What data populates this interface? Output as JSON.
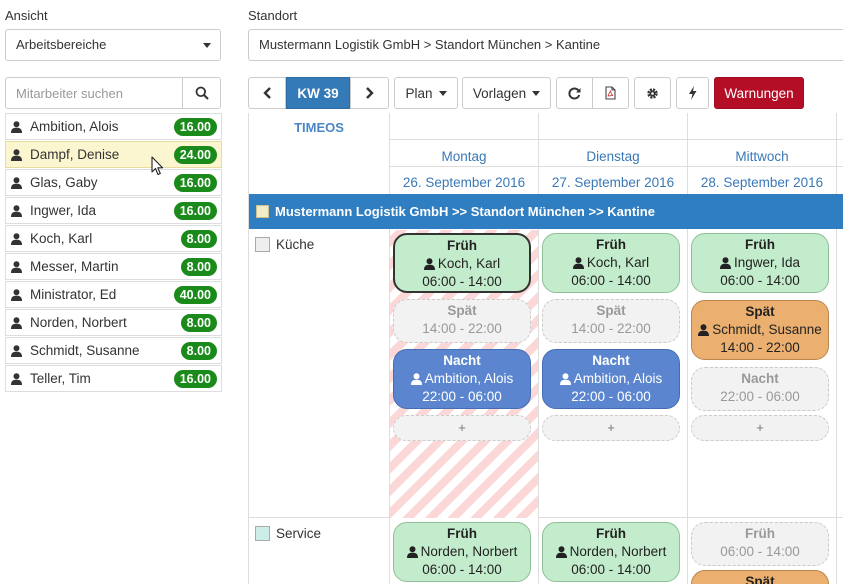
{
  "left": {
    "ansicht_label": "Ansicht",
    "ansicht_value": "Arbeitsbereiche",
    "search_placeholder": "Mitarbeiter suchen",
    "employees": [
      {
        "name": "Ambition, Alois",
        "hours": "16.00"
      },
      {
        "name": "Dampf, Denise",
        "hours": "24.00"
      },
      {
        "name": "Glas, Gaby",
        "hours": "16.00"
      },
      {
        "name": "Ingwer, Ida",
        "hours": "16.00"
      },
      {
        "name": "Koch, Karl",
        "hours": "8.00"
      },
      {
        "name": "Messer, Martin",
        "hours": "8.00"
      },
      {
        "name": "Ministrator, Ed",
        "hours": "40.00"
      },
      {
        "name": "Norden, Norbert",
        "hours": "8.00"
      },
      {
        "name": "Schmidt, Susanne",
        "hours": "8.00"
      },
      {
        "name": "Teller, Tim",
        "hours": "16.00"
      }
    ]
  },
  "standort": {
    "label": "Standort",
    "value": "Mustermann Logistik GmbH > Standort München > Kantine"
  },
  "toolbar": {
    "week": "KW 39",
    "plan": "Plan",
    "vorlagen": "Vorlagen",
    "warnings": "Warnungen"
  },
  "colors": {
    "accent": "#337ab7",
    "warning": "#b40d26",
    "badge": "#1a8a1a"
  },
  "calendar": {
    "brand": "TIMEOS",
    "days": [
      {
        "name": "Montag",
        "date": "26. September 2016"
      },
      {
        "name": "Dienstag",
        "date": "27. September 2016"
      },
      {
        "name": "Mittwoch",
        "date": "28. September 2016"
      }
    ],
    "location_bar": "Mustermann Logistik GmbH >> Standort München >> Kantine",
    "groups": [
      "Küche",
      "Service"
    ],
    "add_label": "+",
    "kueche": [
      [
        {
          "title": "Früh",
          "person": "Koch, Karl",
          "time": "06:00 - 14:00"
        },
        {
          "title": "Spät",
          "time": "14:00 - 22:00"
        },
        {
          "title": "Nacht",
          "person": "Ambition, Alois",
          "time": "22:00 - 06:00"
        }
      ],
      [
        {
          "title": "Früh",
          "person": "Koch, Karl",
          "time": "06:00 - 14:00"
        },
        {
          "title": "Spät",
          "time": "14:00 - 22:00"
        },
        {
          "title": "Nacht",
          "person": "Ambition, Alois",
          "time": "22:00 - 06:00"
        }
      ],
      [
        {
          "title": "Früh",
          "person": "Ingwer, Ida",
          "time": "06:00 - 14:00"
        },
        {
          "title": "Spät",
          "person": "Schmidt, Susanne",
          "time": "14:00 - 22:00"
        },
        {
          "title": "Nacht",
          "time": "22:00 - 06:00"
        }
      ]
    ],
    "service": [
      [
        {
          "title": "Früh",
          "person": "Norden, Norbert",
          "time": "06:00 - 14:00"
        }
      ],
      [
        {
          "title": "Früh",
          "person": "Norden, Norbert",
          "time": "06:00 - 14:00"
        }
      ],
      [
        {
          "title": "Früh",
          "time": "06:00 - 14:00"
        },
        {
          "title": "Spät"
        }
      ]
    ]
  }
}
